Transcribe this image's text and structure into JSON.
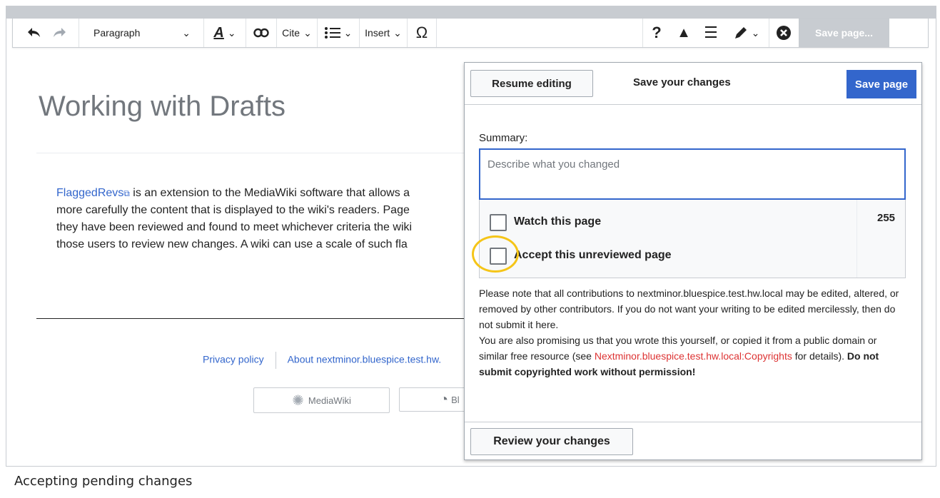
{
  "toolbar": {
    "undo_icon": "undo-icon",
    "redo_icon": "redo-icon",
    "format": "Paragraph",
    "text_style_icon": "text-style-icon",
    "link_icon": "link-icon",
    "cite": "Cite",
    "list_icon": "list-icon",
    "insert": "Insert",
    "special_char": "Ω",
    "help": "?",
    "notices": "▲",
    "menu": "☰",
    "edit_mode_icon": "pencil-icon",
    "close_icon": "close-icon",
    "save": "Save page..."
  },
  "article": {
    "title": "Working with Drafts",
    "link": "FlaggedRevs",
    "line1_rest": " is an extension to the MediaWiki software that allows a",
    "line2": "more carefully the content that is displayed to the wiki's readers. Page",
    "line3": "they have been reviewed and found to meet whichever criteria the wiki",
    "line4": "those users to review new changes. A wiki can use a scale of such fla"
  },
  "footer": {
    "privacy": "Privacy policy",
    "about": "About nextminor.bluespice.test.hw.",
    "mediawiki_badge": "MediaWiki",
    "bluespice_badge": "Bl"
  },
  "dialog": {
    "resume_button": "Resume editing",
    "title": "Save your changes",
    "save_button": "Save page",
    "summary_label": "Summary:",
    "summary_placeholder": "Describe what you changed",
    "watch_label": "Watch this page",
    "accept_label": "Accept this unreviewed page",
    "char_counter": "255",
    "license_p1": "Please note that all contributions to nextminor.bluespice.test.hw.local may be edited, altered, or removed by other contributors. If you do not want your writing to be edited mercilessly, then do not submit it here.",
    "license_p2_start": "You are also promising us that you wrote this yourself, or copied it from a public domain or similar free resource (see ",
    "license_link": "Nextminor.bluespice.test.hw.local:Copyrights",
    "license_p2_end": " for details). ",
    "license_bold": "Do not submit copyrighted work without permission!",
    "review_button": "Review your changes"
  },
  "caption": "Accepting pending changes",
  "colors": {
    "accent": "#3366cc",
    "highlight": "#f5c518",
    "link_red": "#dd3333"
  }
}
